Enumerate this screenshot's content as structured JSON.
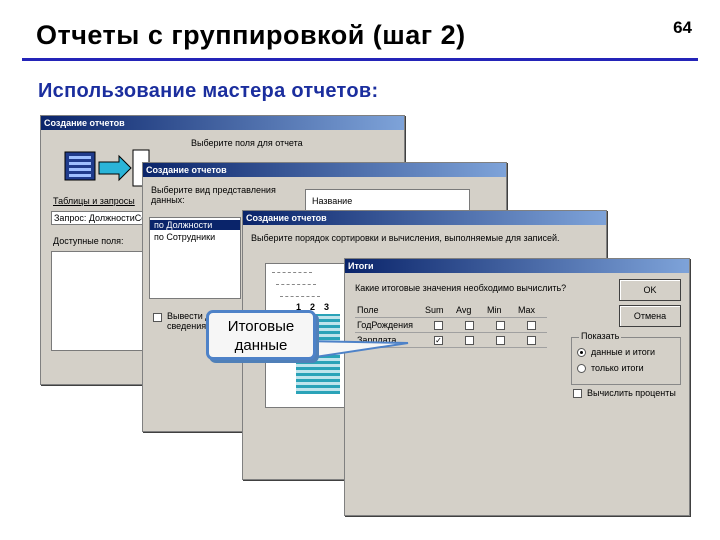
{
  "slide": {
    "title": "Отчеты с группировкой (шаг 2)",
    "number": "64",
    "subtitle": "Использование мастера отчетов:"
  },
  "dialog1": {
    "title": "Создание отчетов",
    "choose_fields": "Выберите поля для отчета",
    "tables_label": "Таблицы и запросы",
    "tables_value": "Запрос: ДолжностиСот",
    "available_label": "Доступные поля:"
  },
  "dialog2": {
    "title": "Создание отчетов",
    "choose_view_1": "Выберите вид представления",
    "choose_view_2": "данных:",
    "items": [
      "по Должности",
      "по Сотрудники"
    ],
    "field_name": "Название",
    "checkbox_1": "Вывести д",
    "checkbox_2": "сведения"
  },
  "dialog3": {
    "title": "Создание отчетов",
    "instruction": "Выберите порядок сортировки и вычисления, выполняемые для записей.",
    "columns": [
      "1",
      "2",
      "3"
    ]
  },
  "dialog4": {
    "title": "Итоги",
    "question": "Какие итоговые значения необходимо вычислить?",
    "ok": "OK",
    "cancel": "Отмена",
    "headers": [
      "Поле",
      "Sum",
      "Avg",
      "Min",
      "Max"
    ],
    "rows": [
      {
        "field": "ГодРождения",
        "checks": [
          false,
          false,
          false,
          false
        ]
      },
      {
        "field": "Зарплата",
        "checks": [
          true,
          false,
          false,
          false
        ]
      }
    ],
    "show_group": "Показать",
    "radio_1": "данные и итоги",
    "radio_2": "только итоги",
    "percent": "Вычислить проценты"
  },
  "callout": {
    "line1": "Итоговые",
    "line2": "данные"
  },
  "colors": {
    "accent": "#1b2e9e",
    "rule": "#2424b8",
    "titlebar": "#0a246a",
    "callout_border": "#4e82c8"
  }
}
